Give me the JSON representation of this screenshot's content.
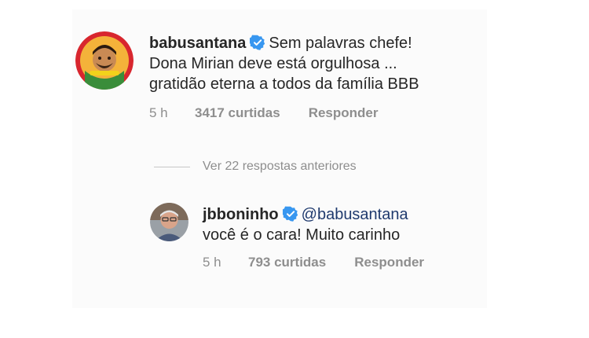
{
  "comments": [
    {
      "username": "babusantana",
      "text_lines": [
        "Sem palavras chefe!",
        "Dona Mirian deve está orgulhosa ...",
        "gratidão eterna a todos da família BBB"
      ],
      "time": "5 h",
      "likes": "3417 curtidas",
      "reply_label": "Responder",
      "verified": true,
      "avatar_colors": {
        "ring": "#d8262e",
        "fill": "#f4b23a"
      }
    },
    {
      "username": "jbboninho",
      "mention": "@babusantana",
      "text_line": "você é o cara! Muito carinho",
      "time": "5 h",
      "likes": "793 curtidas",
      "reply_label": "Responder",
      "verified": true
    }
  ],
  "view_previous_replies": "Ver 22 respostas anteriores",
  "colors": {
    "verified": "#3897f0",
    "muted": "#8e8e8e",
    "text": "#262626"
  }
}
